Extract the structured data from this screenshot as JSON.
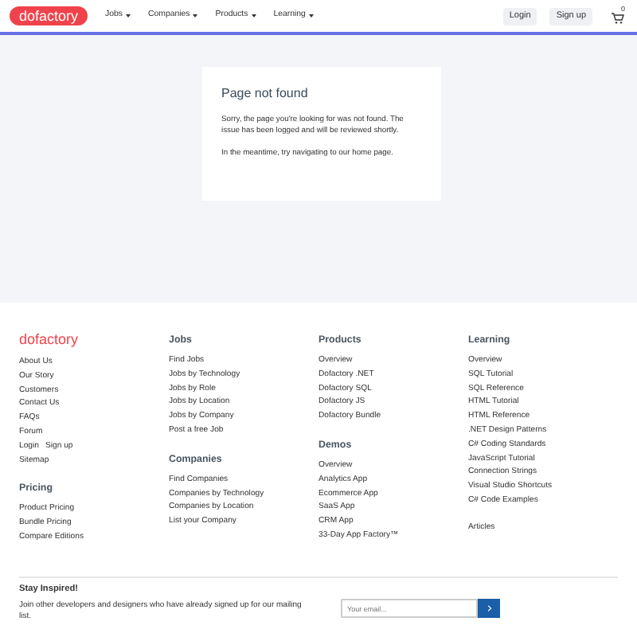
{
  "navbar": {
    "logo": "dofactory",
    "menus": [
      {
        "label": "Jobs"
      },
      {
        "label": "Companies"
      },
      {
        "label": "Products"
      },
      {
        "label": "Learning"
      }
    ],
    "buttons": [
      "Login",
      "Sign up"
    ],
    "cart_count": "0"
  },
  "error_card": {
    "title": "Page not found",
    "message": "Sorry, the page you're looking for was not found. The issue has been logged and will be reviewed shortly.",
    "hint": "In the meantime, try navigating to our ",
    "link": "home page",
    "hint_end": "."
  },
  "footer": {
    "columns": [
      {
        "sections": [
          {
            "kind": "logo",
            "title": "dofactory",
            "lines": [
              [
                "About Us"
              ],
              [
                "Our Story"
              ],
              [
                "Customers"
              ],
              [
                "Contact Us"
              ],
              [
                "FAQs"
              ],
              [
                "Forum"
              ],
              [
                "Login",
                "Sign up"
              ],
              [
                "Sitemap"
              ]
            ]
          },
          {
            "kind": "heading",
            "title": "Pricing",
            "lines": [
              [
                "Product Pricing"
              ],
              [
                "Bundle Pricing"
              ],
              [
                "Compare Editions"
              ]
            ]
          }
        ]
      },
      {
        "sections": [
          {
            "kind": "heading",
            "title": "Jobs",
            "lines": [
              [
                "Find Jobs"
              ],
              [
                "Jobs by Technology"
              ],
              [
                "Jobs by Role"
              ],
              [
                "Jobs by Location"
              ],
              [
                "Jobs by Company"
              ],
              [
                "Post a free Job"
              ]
            ]
          },
          {
            "kind": "heading",
            "title": "Companies",
            "lines": [
              [
                "Find Companies"
              ],
              [
                "Companies by Technology"
              ],
              [
                "Companies by Location"
              ],
              [
                "List your Company"
              ]
            ]
          }
        ]
      },
      {
        "sections": [
          {
            "kind": "heading",
            "title": "Products",
            "lines": [
              [
                "Overview"
              ],
              [
                "Dofactory .NET"
              ],
              [
                "Dofactory SQL"
              ],
              [
                "Dofactory JS"
              ],
              [
                "Dofactory Bundle"
              ]
            ]
          },
          {
            "kind": "heading",
            "title": "Demos",
            "lines": [
              [
                "Overview"
              ],
              [
                "Analytics App"
              ],
              [
                "Ecommerce App"
              ],
              [
                "SaaS App"
              ],
              [
                "CRM App"
              ],
              [
                "33-Day App Factory™"
              ]
            ]
          }
        ]
      },
      {
        "sections": [
          {
            "kind": "heading",
            "title": "Learning",
            "lines": [
              [
                "Overview"
              ],
              [
                "SQL Tutorial"
              ],
              [
                "SQL Reference"
              ],
              [
                "HTML Tutorial"
              ],
              [
                "HTML Reference"
              ],
              [
                ".NET Design Patterns"
              ],
              [
                "C# Coding Standards"
              ],
              [
                "JavaScript Tutorial"
              ],
              [
                "Connection Strings"
              ],
              [
                "Visual Studio Shortcuts"
              ],
              [
                "C# Code Examples"
              ]
            ]
          },
          {
            "kind": "plain",
            "lines": [
              [
                "Articles"
              ]
            ]
          }
        ]
      }
    ],
    "newsletter": {
      "title": "Stay Inspired!",
      "text": "Join other developers and designers who have already signed up for our mailing list.",
      "placeholder": "Your email..."
    }
  }
}
